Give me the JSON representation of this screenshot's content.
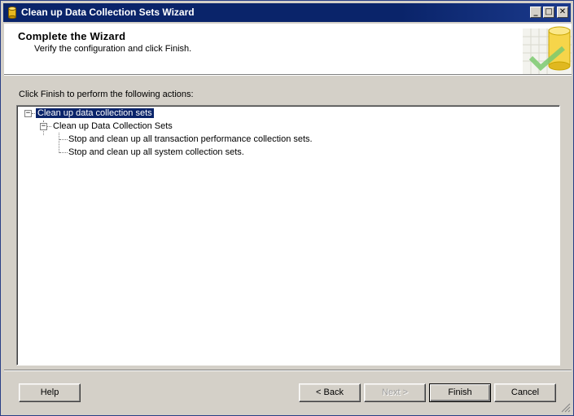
{
  "window": {
    "title": "Clean up Data Collection Sets Wizard"
  },
  "titlebar_buttons": {
    "minimize": "_",
    "maximize": "□",
    "close": "✕"
  },
  "header": {
    "title": "Complete the Wizard",
    "subtitle": "Verify the configuration and click Finish."
  },
  "instructions": "Click Finish to perform the following actions:",
  "tree": {
    "root": {
      "label": "Clean up data collection sets",
      "expanded": true,
      "selected": true
    },
    "child": {
      "label": "Clean up Data Collection Sets",
      "expanded": true
    },
    "leaves": [
      "Stop and clean up all transaction performance collection sets.",
      "Stop and clean up all system collection sets."
    ],
    "expander_symbol": "−"
  },
  "buttons": {
    "help": "Help",
    "back": "< Back",
    "next": "Next >",
    "finish": "Finish",
    "cancel": "Cancel"
  },
  "colors": {
    "titlebar": "#0a246a",
    "selection": "#0a246a",
    "face": "#d4d0c8"
  }
}
